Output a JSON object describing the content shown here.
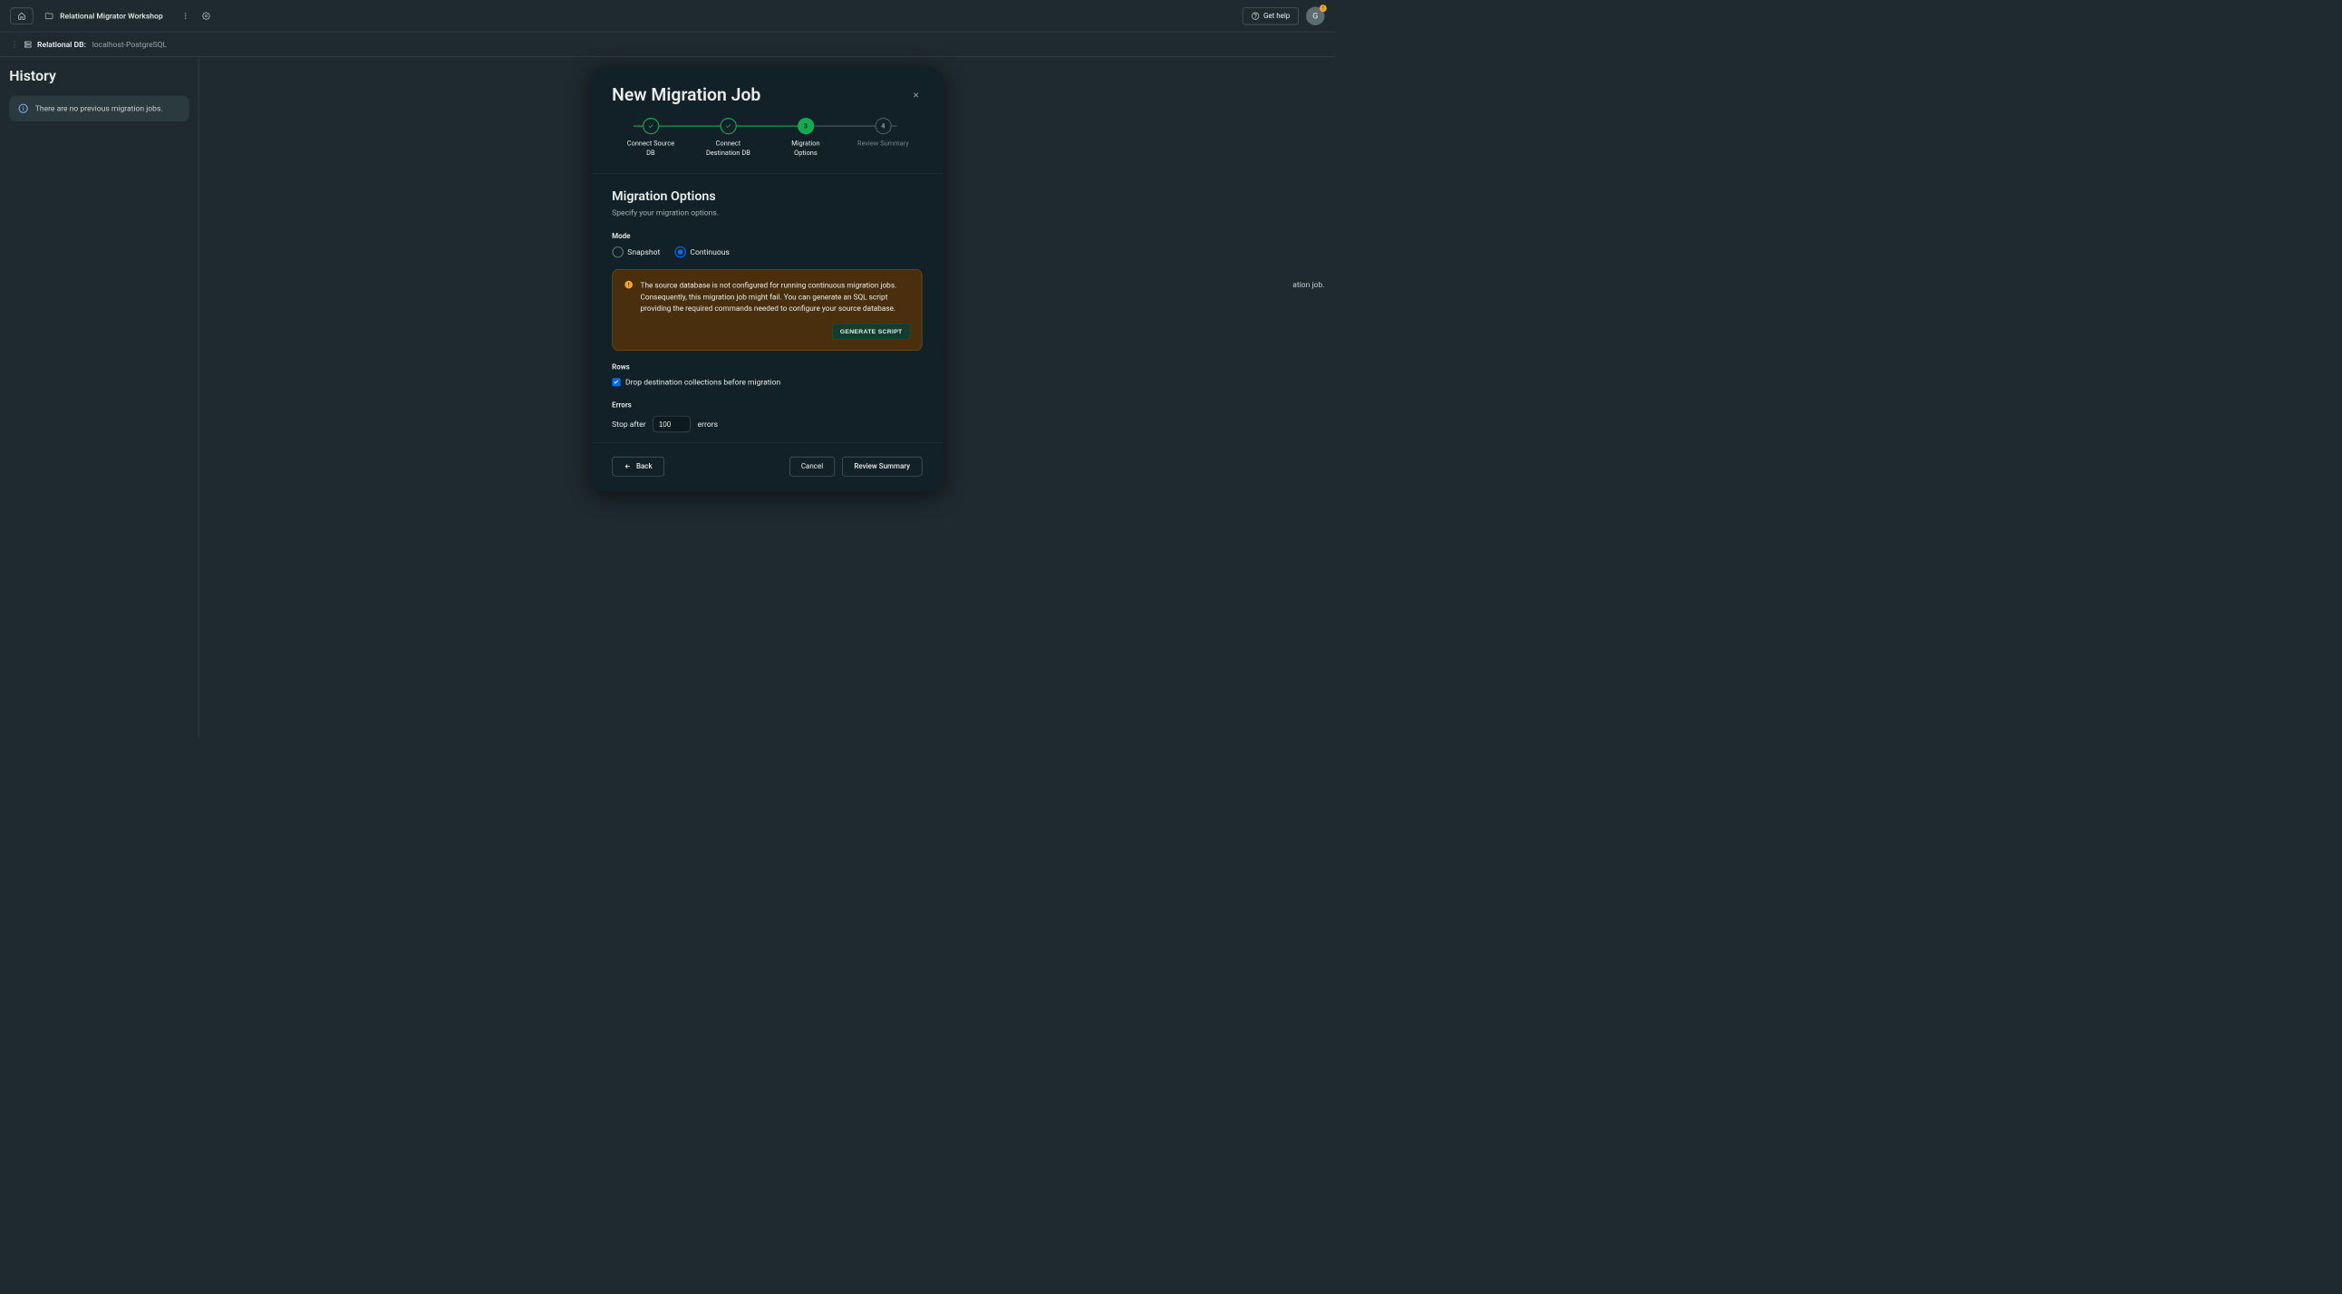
{
  "topbar": {
    "project_title": "Relational Migrator Workshop",
    "get_help": "Get help",
    "avatar_initial": "G"
  },
  "subbar": {
    "label": "Relational DB:",
    "value": "localhost-PostgreSQL"
  },
  "sidebar": {
    "title": "History",
    "empty_message": "There are no previous migration jobs."
  },
  "main_hint_fragment": "ation job.",
  "modal": {
    "title": "New Migration Job",
    "steps": [
      {
        "label": "Connect Source DB"
      },
      {
        "label": "Connect Destination DB"
      },
      {
        "number": "3",
        "label": "Migration Options"
      },
      {
        "number": "4",
        "label": "Review Summary"
      }
    ],
    "section_title": "Migration Options",
    "section_sub": "Specify your migration options.",
    "mode_label": "Mode",
    "mode_options": {
      "snapshot": "Snapshot",
      "continuous": "Continuous"
    },
    "warning_text": "The source database is not configured for running continuous migration jobs. Consequently, this migration job might fail. You can generate an SQL script providing the required commands needed to configure your source database.",
    "generate_script": "GENERATE SCRIPT",
    "rows_label": "Rows",
    "drop_collections": "Drop destination collections before migration",
    "errors_label": "Errors",
    "stop_after": "Stop after",
    "stop_after_value": "100",
    "errors_suffix": "errors",
    "back": "Back",
    "cancel": "Cancel",
    "review_summary": "Review Summary"
  }
}
